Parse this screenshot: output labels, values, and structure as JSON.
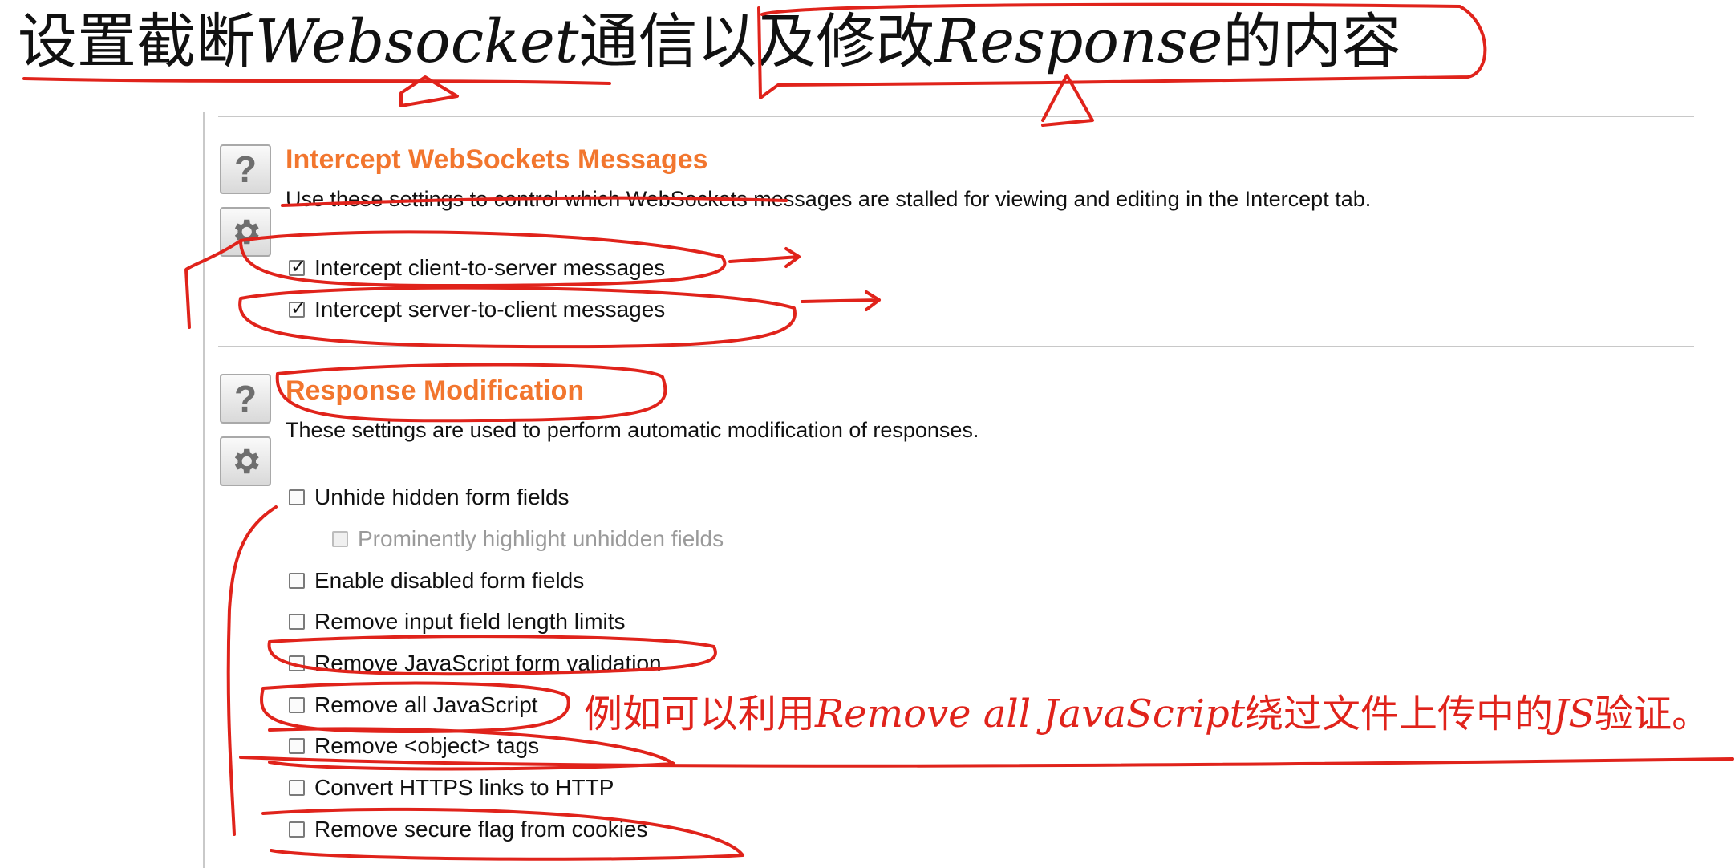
{
  "heading": {
    "part1": "设置截断",
    "part2": "Websocket",
    "part3": "通信以及修改",
    "part4": "Response",
    "part5": "的内容"
  },
  "websockets_section": {
    "help_label": "?",
    "icon": "gear-icon",
    "title": "Intercept WebSockets Messages",
    "description": "Use these settings to control which WebSockets messages are stalled for viewing and editing in the Intercept tab.",
    "options": [
      {
        "label": "Intercept client-to-server messages",
        "checked": true
      },
      {
        "label": "Intercept server-to-client messages",
        "checked": true
      }
    ]
  },
  "response_section": {
    "help_label": "?",
    "icon": "gear-icon",
    "title": "Response Modification",
    "description": "These settings are used to perform automatic modification of responses.",
    "options": [
      {
        "label": "Unhide hidden form fields",
        "checked": false
      },
      {
        "label": "Prominently highlight unhidden fields",
        "checked": false,
        "disabled": true
      },
      {
        "label": "Enable disabled form fields",
        "checked": false
      },
      {
        "label": "Remove input field length limits",
        "checked": false
      },
      {
        "label": "Remove JavaScript form validation",
        "checked": false
      },
      {
        "label": "Remove all JavaScript",
        "checked": false
      },
      {
        "label": "Remove <object> tags",
        "checked": false
      },
      {
        "label": "Convert HTTPS links to HTTP",
        "checked": false
      },
      {
        "label": "Remove secure flag from cookies",
        "checked": false
      }
    ]
  },
  "annotation": {
    "part1": "例如可以利用",
    "part2": "Remove all JavaScript",
    "part3": "绕过文件上传中的",
    "part4": "JS",
    "part5": "验证。"
  },
  "colors": {
    "section_title": "#f2762e",
    "annotation_ink": "#e0231b"
  }
}
